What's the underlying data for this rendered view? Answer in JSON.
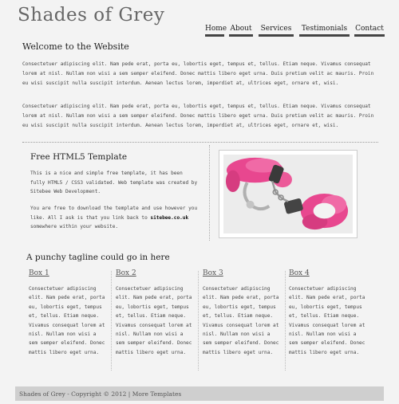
{
  "header": {
    "site_title": "Shades of Grey",
    "nav": [
      {
        "label": "Home"
      },
      {
        "label": "About"
      },
      {
        "label": "Services"
      },
      {
        "label": "Testimonials"
      },
      {
        "label": "Contact"
      }
    ]
  },
  "welcome": {
    "heading": "Welcome to the Website",
    "paragraphs": [
      "Consectetuer adipiscing elit. Nam pede erat, porta eu, lobortis eget, tempus et, tellus. Etiam neque. Vivamus consequat lorem at nisl. Nullam non wisi a sem semper eleifend. Donec mattis libero eget urna. Duis pretium velit ac mauris. Proin eu wisi suscipit nulla suscipit interdum. Aenean lectus lorem, imperdiet at, ultrices eget, ornare et, wisi.",
      "Consectetuer adipiscing elit. Nam pede erat, porta eu, lobortis eget, tempus et, tellus. Etiam neque. Vivamus consequat lorem at nisl. Nullam non wisi a sem semper eleifend. Donec mattis libero eget urna. Duis pretium velit ac mauris. Proin eu wisi suscipit nulla suscipit interdum. Aenean lectus lorem, imperdiet at, ultrices eget, ornare et, wisi."
    ]
  },
  "template": {
    "heading": "Free HTML5 Template",
    "text1": "This is a nice and simple free template, it has been fully HTML5 / CSS3 validated. Web template was created by Sitebee Web Development.",
    "text2_pre": "You are free to download the template and use however you like. All I ask is that you link back to ",
    "text2_bold": "sitebee.co.uk",
    "text2_post": " somewhere within your website."
  },
  "tagline": {
    "heading": "A punchy tagline could go in here",
    "boxes": [
      {
        "title": "Box 1",
        "text": "Consectetuer adipiscing elit. Nam pede erat, porta eu, lobortis eget, tempus et, tellus. Etiam neque. Vivamus consequat lorem at nisl. Nullam non wisi a sem semper eleifend. Donec mattis libero eget urna."
      },
      {
        "title": "Box 2",
        "text": "Consectetuer adipiscing elit. Nam pede erat, porta eu, lobortis eget, tempus et, tellus. Etiam neque. Vivamus consequat lorem at nisl. Nullam non wisi a sem semper eleifend. Donec mattis libero eget urna."
      },
      {
        "title": "Box 3",
        "text": "Consectetuer adipiscing elit. Nam pede erat, porta eu, lobortis eget, tempus et, tellus. Etiam neque. Vivamus consequat lorem at nisl. Nullam non wisi a sem semper eleifend. Donec mattis libero eget urna."
      },
      {
        "title": "Box 4",
        "text": "Consectetuer adipiscing elit. Nam pede erat, porta eu, lobortis eget, tempus et, tellus. Etiam neque. Vivamus consequat lorem at nisl. Nullam non wisi a sem semper eleifend. Donec mattis libero eget urna."
      }
    ]
  },
  "footer": {
    "text": "Shades of Grey - Copyright © 2012 | More Templates"
  },
  "colors": {
    "background": "#f3f3f3",
    "footer_bar": "#cfcfcf",
    "accent_pink": "#e8478f"
  },
  "icons": {
    "hero": "handcuffs-photo"
  }
}
